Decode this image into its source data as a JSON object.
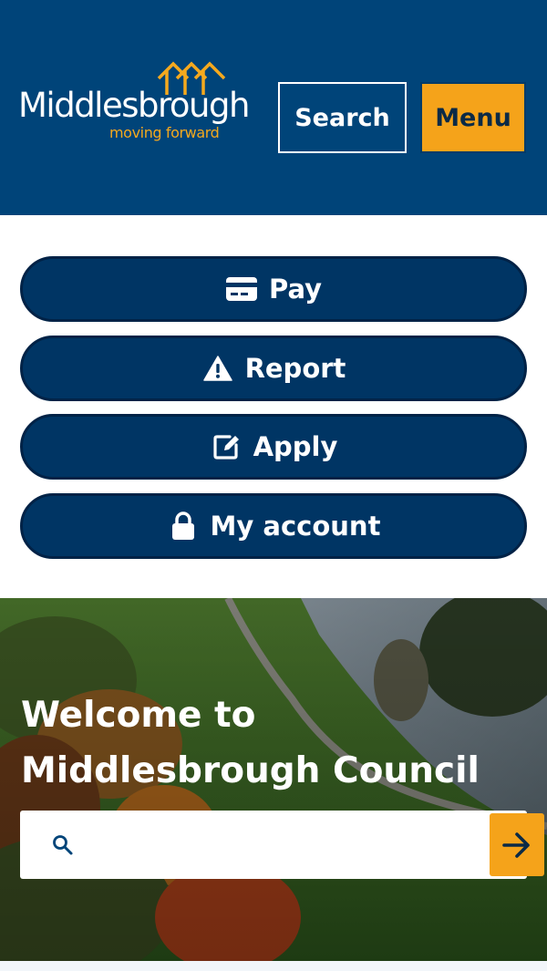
{
  "header": {
    "logo": {
      "wordmark": "Middlesbrough",
      "tagline": "moving forward",
      "icon": "triple-house-roof-icon"
    },
    "search_label": "Search",
    "menu_label": "Menu"
  },
  "quick_links": [
    {
      "label": "Pay",
      "icon": "credit-card-icon"
    },
    {
      "label": "Report",
      "icon": "warning-triangle-icon"
    },
    {
      "label": "Apply",
      "icon": "edit-form-icon"
    },
    {
      "label": "My account",
      "icon": "lock-icon"
    }
  ],
  "hero": {
    "title": "Welcome to Middlesbrough Council",
    "search": {
      "placeholder": "",
      "value": "",
      "icon": "search-icon",
      "submit_icon": "arrow-right-icon"
    }
  },
  "colors": {
    "brand_blue": "#004479",
    "pill_blue": "#003564",
    "accent_orange": "#f5a31a",
    "white": "#ffffff"
  }
}
